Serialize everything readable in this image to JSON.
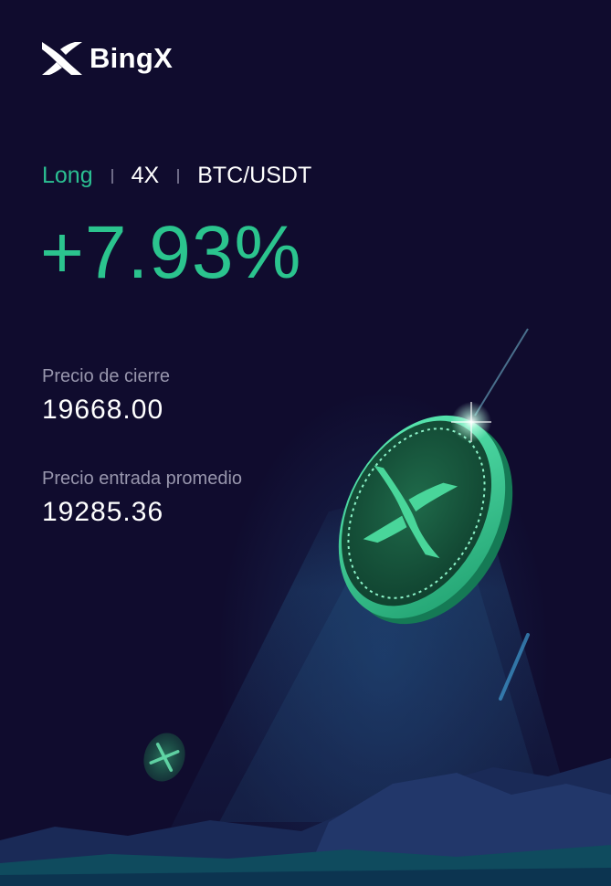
{
  "brand": {
    "name": "BingX"
  },
  "trade": {
    "direction": "Long",
    "leverage": "4X",
    "pair": "BTC/USDT",
    "pnl_percent": "+7.93%"
  },
  "stats": {
    "close_price_label": "Precio de cierre",
    "close_price_value": "19668.00",
    "avg_entry_label": "Precio entrada promedio",
    "avg_entry_value": "19285.36"
  },
  "colors": {
    "background": "#100c2e",
    "accent_green": "#2bc48e",
    "label_gray": "#9896ad",
    "text_white": "#ffffff"
  },
  "icons": [
    "bingx-logo-icon",
    "coin-illustration",
    "small-coin-icon",
    "mountain-illustration"
  ]
}
